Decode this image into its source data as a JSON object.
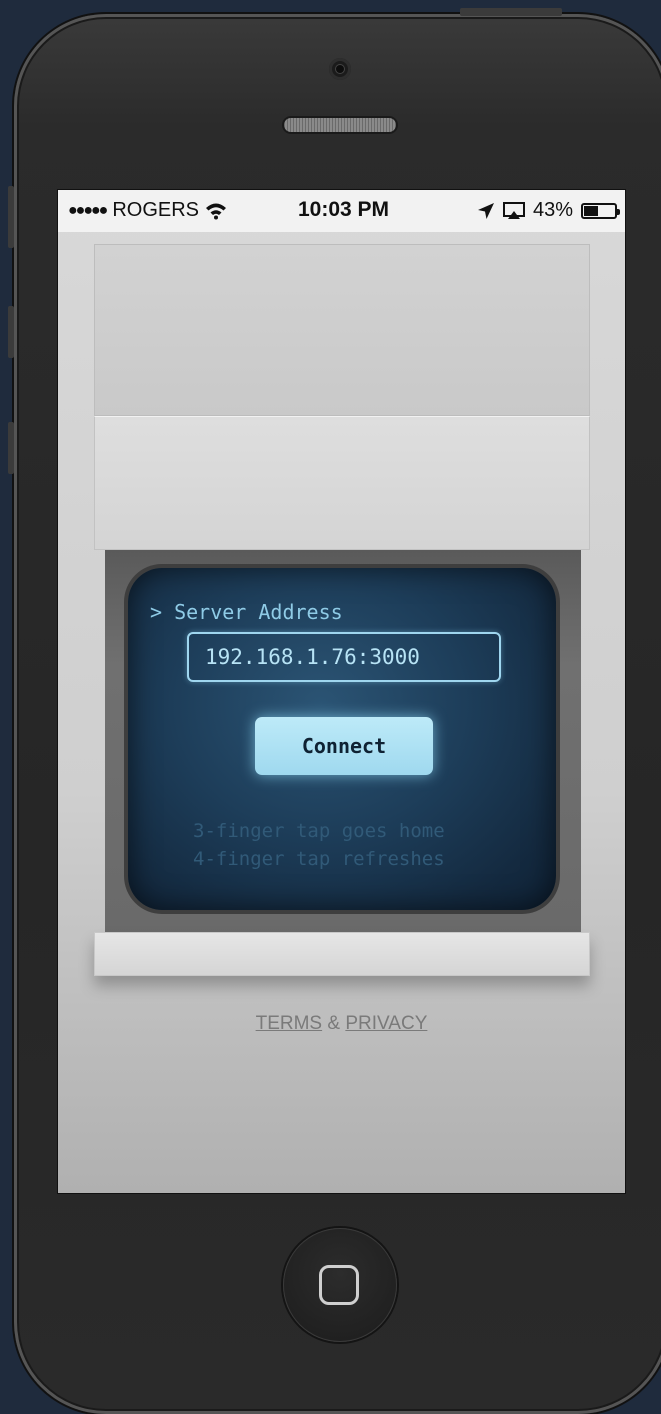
{
  "status_bar": {
    "signal_dots": "●●●●●",
    "carrier": "ROGERS",
    "time": "10:03 PM",
    "battery_percent": "43%",
    "battery_level": 0.43
  },
  "terminal": {
    "prompt_label": "> Server Address",
    "server_address_value": "192.168.1.76:3000",
    "connect_label": "Connect",
    "hint_line_1": "3-finger tap goes home",
    "hint_line_2": "4-finger tap refreshes"
  },
  "footer": {
    "terms_label": "TERMS",
    "ampersand": "&",
    "privacy_label": "PRIVACY"
  },
  "colors": {
    "background": "#1f2b3d",
    "crt_text": "#8fcbe6",
    "button_fill": "#9fd9ef",
    "hint_text": "#315a78"
  }
}
